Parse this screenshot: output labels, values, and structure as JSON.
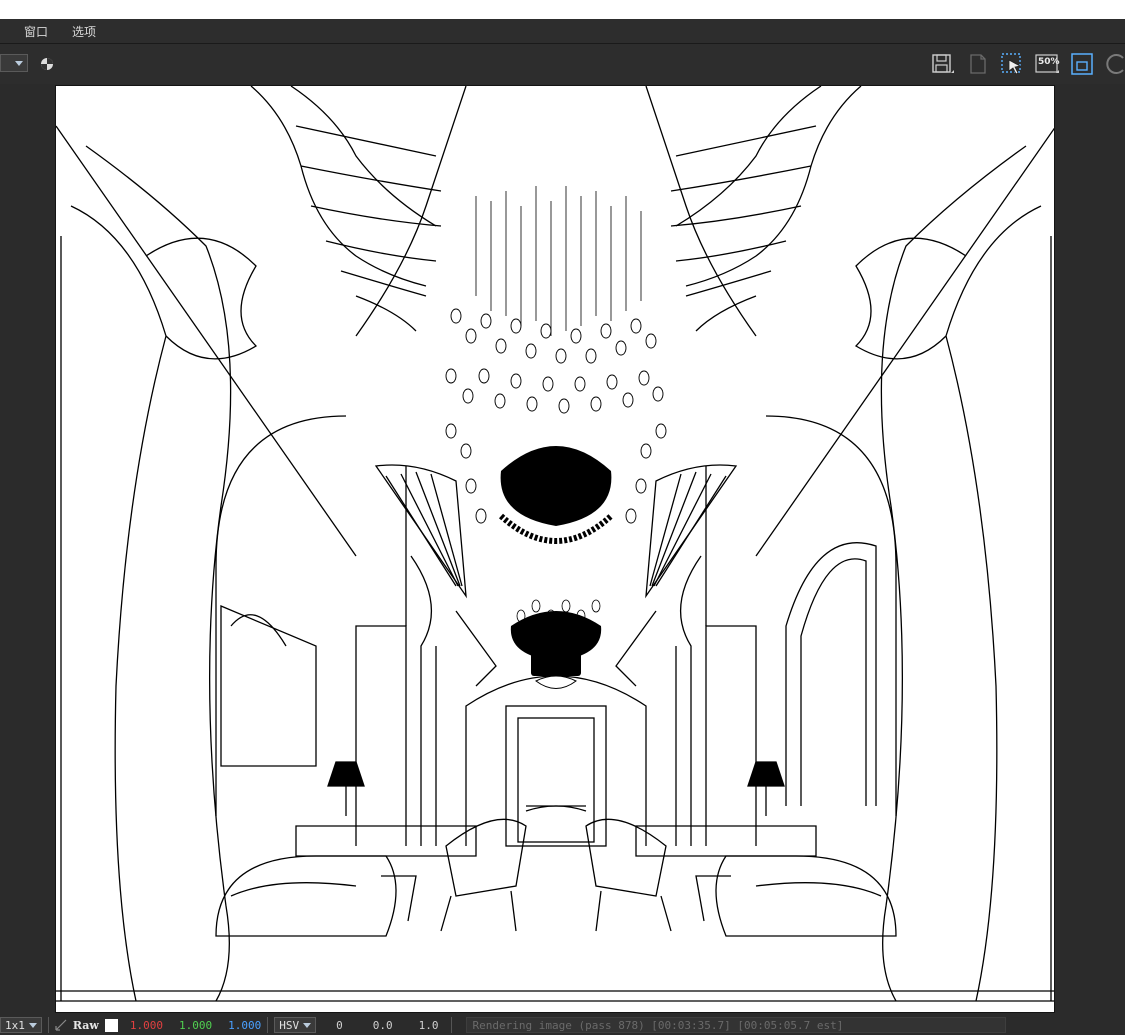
{
  "menu": {
    "items": [
      "窗口",
      "选项"
    ]
  },
  "toolbar": {
    "icons": [
      "save-icon",
      "clear-image-icon",
      "region-render-icon",
      "zoom-50-icon",
      "frame-icon",
      "history-icon"
    ],
    "zoom_badge": "50%"
  },
  "status": {
    "zoom_label": "1x1",
    "mode": "Raw",
    "swatch_color": "#ffffff",
    "r": "1.000",
    "g": "1.000",
    "b": "1.000",
    "colorspace": "HSV",
    "h": "0",
    "s": "0.0",
    "v": "1.0",
    "message": "Rendering image (pass 878) [00:03:35.7] [00:05:05.7 est]"
  },
  "colors": {
    "r": "#e04040",
    "g": "#50d050",
    "b": "#4aa0ff"
  }
}
